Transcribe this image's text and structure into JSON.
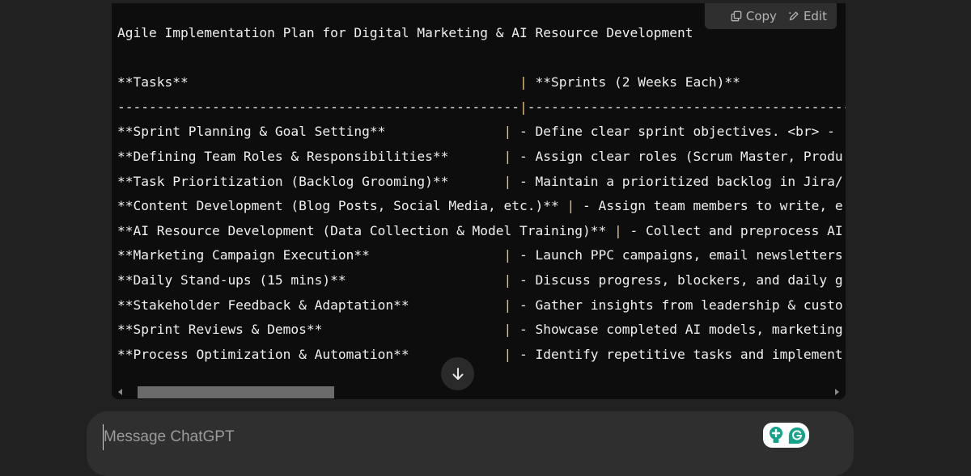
{
  "code_block": {
    "toolbar": {
      "copy_label": "Copy",
      "edit_label": "Edit",
      "copy_icon": "copy-icon",
      "edit_icon": "pencil-icon"
    },
    "lines": [
      "Agile Implementation Plan for Digital Marketing & AI Resource Development",
      "",
      "**Tasks**                                          | **Sprints (2 Weeks Each)**",
      "---------------------------------------------------|--------------------------------------------------",
      "**Sprint Planning & Goal Setting**               | - Define clear sprint objectives. <br> - ",
      "**Defining Team Roles & Responsibilities**       | - Assign clear roles (Scrum Master, Produ",
      "**Task Prioritization (Backlog Grooming)**       | - Maintain a prioritized backlog in Jira/",
      "**Content Development (Blog Posts, Social Media, etc.)** | - Assign team members to write, e",
      "**AI Resource Development (Data Collection & Model Training)** | - Collect and preprocess AI",
      "**Marketing Campaign Execution**                 | - Launch PPC campaigns, email newsletters",
      "**Daily Stand-ups (15 mins)**                    | - Discuss progress, blockers, and daily g",
      "**Stakeholder Feedback & Adaptation**            | - Gather insights from leadership & custo",
      "**Sprint Reviews & Demos**                       | - Showcase completed AI models, marketing",
      "**Process Optimization & Automation**            | - Identify repetitive tasks and implement"
    ],
    "scroll_down_icon": "arrow-down-icon",
    "horizontal_scroll_fraction": 0.27
  },
  "composer": {
    "placeholder": "Message ChatGPT",
    "value": "",
    "extension_icons": [
      "lightbulb-plus-icon",
      "grammarly-icon"
    ]
  },
  "colors": {
    "page_bg": "#212121",
    "code_bg": "#0d0d0d",
    "composer_bg": "#2f2f2f",
    "grammarly_green": "#15c39a"
  }
}
